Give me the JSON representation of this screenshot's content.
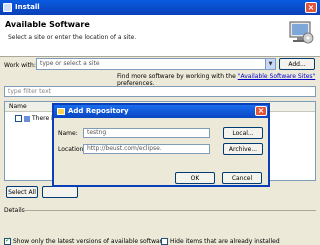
{
  "window": {
    "title": "Install"
  },
  "header": {
    "title": "Available Software",
    "description": "Select a site or enter the location of a site."
  },
  "work_with": {
    "label": "Work with:",
    "placeholder": "type or select a site",
    "add_button": "Add..."
  },
  "find_more": {
    "prefix": "Find more software by working with the ",
    "link": "\"Available Software Sites\"",
    "suffix": " preferences."
  },
  "filter": {
    "placeholder": "type filter text"
  },
  "table": {
    "columns": [
      "Name"
    ],
    "rows": [
      {
        "label": "There i"
      }
    ]
  },
  "buttons": {
    "select_all": "Select All"
  },
  "details": {
    "label": "Details"
  },
  "options": {
    "show_latest": "Show only the latest versions of available software",
    "hide_installed": "Hide items that are already installed"
  },
  "dialog": {
    "title": "Add Repository",
    "name_label": "Name:",
    "name_value": "testng",
    "location_label": "Location:",
    "location_value": "http://beust.com/eclipse.",
    "local_button": "Local...",
    "archive_button": "Archive...",
    "ok_button": "OK",
    "cancel_button": "Cancel"
  }
}
